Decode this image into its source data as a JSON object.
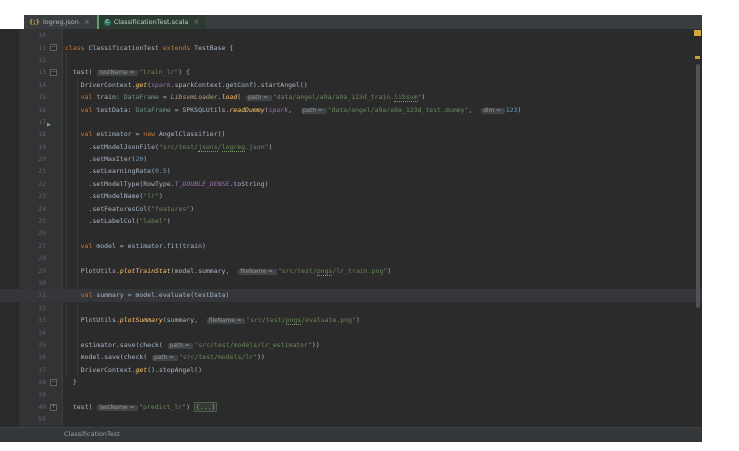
{
  "tabs": [
    {
      "label": "logreg.json",
      "icon": "json-file-icon",
      "close": "×",
      "active": false
    },
    {
      "label": "ClassificationTest.scala",
      "icon": "scala-test-class-icon",
      "close": "×",
      "active": true
    }
  ],
  "breadcrumb": "ClassificationTest",
  "colors": {
    "editor_bg": "#2b2b2b",
    "gutter_bg": "#313335",
    "tabbar_bg": "#3a3d3f",
    "active_tab_bg": "#2c3a31",
    "active_tab_accent": "#57a368",
    "keyword": "#cc7832",
    "string": "#6a8759",
    "number": "#6897bb",
    "default_text": "#a9b7c6",
    "line_number": "#606366",
    "error_stripe_marker": "#d4a740",
    "caret_line_bg": "#343639"
  },
  "editor": {
    "caret_line": 31,
    "lines": [
      {
        "n": 10,
        "t": []
      },
      {
        "n": 11,
        "fold": "minus",
        "t": [
          [
            "kw",
            "class "
          ],
          [
            "pl",
            "ClassificationTest "
          ],
          [
            "kw",
            "extends "
          ],
          [
            "pl",
            "TestBase {"
          ]
        ]
      },
      {
        "n": 12,
        "t": []
      },
      {
        "n": 13,
        "fold": "minus",
        "t": [
          [
            "pl",
            "  test( "
          ],
          [
            "hint",
            "testName = "
          ],
          [
            "str",
            "\"train_lr\""
          ],
          [
            "pl",
            ") {"
          ]
        ]
      },
      {
        "n": 14,
        "t": [
          [
            "pl",
            "    DriverContext."
          ],
          [
            "itm",
            "get"
          ],
          [
            "pl",
            "("
          ],
          [
            "fld",
            "spark"
          ],
          [
            "pl",
            ".sparkContext.getConf).startAngel()"
          ]
        ]
      },
      {
        "n": 15,
        "t": [
          [
            "kw",
            "    val "
          ],
          [
            "pl",
            "train: "
          ],
          [
            "typ",
            "DataFrame"
          ],
          [
            "pl",
            " = "
          ],
          [
            "obj",
            "LibsvmLoader"
          ],
          [
            "pl",
            "."
          ],
          [
            "itm",
            "load"
          ],
          [
            "pl",
            "( "
          ],
          [
            "hint",
            "path = "
          ],
          [
            "str",
            "\"data/angel/a9a/a9a_123d_train."
          ],
          [
            "ustr",
            "libsvm"
          ],
          [
            "str",
            "\""
          ],
          [
            "pl",
            ")"
          ]
        ]
      },
      {
        "n": 16,
        "t": [
          [
            "kw",
            "    val "
          ],
          [
            "pl",
            "testData: "
          ],
          [
            "typ",
            "DataFrame"
          ],
          [
            "pl",
            " = SPKSQLUtils."
          ],
          [
            "itm",
            "readDummy"
          ],
          [
            "pl",
            "("
          ],
          [
            "fld",
            "spark"
          ],
          [
            "pl",
            ",  "
          ],
          [
            "hint",
            "path = "
          ],
          [
            "str",
            "\"data/angel/a9a/a9a_123d_test.dummy\""
          ],
          [
            "pl",
            ",  "
          ],
          [
            "hint",
            "dim = "
          ],
          [
            "num",
            "123"
          ],
          [
            "pl",
            ")"
          ]
        ]
      },
      {
        "n": 17,
        "marker": "arrow",
        "t": []
      },
      {
        "n": 18,
        "t": [
          [
            "kw",
            "    val "
          ],
          [
            "pl",
            "estimator = "
          ],
          [
            "kw",
            "new "
          ],
          [
            "pl",
            "AngelClassifier()"
          ]
        ]
      },
      {
        "n": 19,
        "t": [
          [
            "pl",
            "      .setModelJsonFile("
          ],
          [
            "str",
            "\"src/test/"
          ],
          [
            "ustr",
            "jsons"
          ],
          [
            "str",
            "/"
          ],
          [
            "ustr",
            "logreg"
          ],
          [
            "str",
            ".json\""
          ],
          [
            "pl",
            ")"
          ]
        ]
      },
      {
        "n": 20,
        "t": [
          [
            "pl",
            "      .setMaxIter("
          ],
          [
            "num",
            "20"
          ],
          [
            "pl",
            ")"
          ]
        ]
      },
      {
        "n": 21,
        "t": [
          [
            "pl",
            "      .setLearningRate("
          ],
          [
            "num",
            "0.5"
          ],
          [
            "pl",
            ")"
          ]
        ]
      },
      {
        "n": 22,
        "t": [
          [
            "pl",
            "      .setModelType(RowType."
          ],
          [
            "fld",
            "T_DOUBLE_DENSE"
          ],
          [
            "pl",
            ".toString)"
          ]
        ]
      },
      {
        "n": 23,
        "t": [
          [
            "pl",
            "      .setModelName("
          ],
          [
            "str",
            "\"lr\""
          ],
          [
            "pl",
            ")"
          ]
        ]
      },
      {
        "n": 24,
        "t": [
          [
            "pl",
            "      .setFeaturesCol("
          ],
          [
            "str",
            "\"features\""
          ],
          [
            "pl",
            ")"
          ]
        ]
      },
      {
        "n": 25,
        "t": [
          [
            "pl",
            "      .setLabelCol("
          ],
          [
            "str",
            "\"label\""
          ],
          [
            "pl",
            ")"
          ]
        ]
      },
      {
        "n": 26,
        "t": []
      },
      {
        "n": 27,
        "t": [
          [
            "kw",
            "    val "
          ],
          [
            "pl",
            "model = estimator.fit(train)"
          ]
        ]
      },
      {
        "n": 28,
        "t": []
      },
      {
        "n": 29,
        "t": [
          [
            "pl",
            "    PlotUtils."
          ],
          [
            "itm",
            "plotTrainStat"
          ],
          [
            "pl",
            "(model.summary,  "
          ],
          [
            "hint",
            "fileName = "
          ],
          [
            "str",
            "\"src/test/"
          ],
          [
            "ustr",
            "pngs"
          ],
          [
            "str",
            "/lr_train.png\""
          ],
          [
            "pl",
            ")"
          ]
        ]
      },
      {
        "n": 30,
        "t": []
      },
      {
        "n": 31,
        "t": [
          [
            "kw",
            "    val "
          ],
          [
            "pl",
            "summary = model.evaluate(testData)"
          ]
        ]
      },
      {
        "n": 32,
        "t": []
      },
      {
        "n": 33,
        "t": [
          [
            "pl",
            "    PlotUtils."
          ],
          [
            "itm",
            "plotSummary"
          ],
          [
            "pl",
            "(summary,  "
          ],
          [
            "hint",
            "fileName = "
          ],
          [
            "str",
            "\"src/test/"
          ],
          [
            "ustr",
            "pngs"
          ],
          [
            "str",
            "/evaluate.png\""
          ],
          [
            "pl",
            ")"
          ]
        ]
      },
      {
        "n": 34,
        "t": []
      },
      {
        "n": 35,
        "t": [
          [
            "pl",
            "    estimator.save(check( "
          ],
          [
            "hint",
            "path = "
          ],
          [
            "str",
            "\"src/test/models/lr_estimator\""
          ],
          [
            "pl",
            "))"
          ]
        ]
      },
      {
        "n": 36,
        "t": [
          [
            "pl",
            "    model.save(check( "
          ],
          [
            "hint",
            "path = "
          ],
          [
            "str",
            "\"src/test/models/lr\""
          ],
          [
            "pl",
            "))"
          ]
        ]
      },
      {
        "n": 37,
        "t": [
          [
            "pl",
            "    DriverContext."
          ],
          [
            "itm",
            "get"
          ],
          [
            "pl",
            "().stopAngel()"
          ]
        ]
      },
      {
        "n": 38,
        "fold": "minus",
        "t": [
          [
            "pl",
            "  }"
          ]
        ]
      },
      {
        "n": 39,
        "t": []
      },
      {
        "n": 40,
        "fold": "plus",
        "t": [
          [
            "pl",
            "  test( "
          ],
          [
            "hint",
            "testName = "
          ],
          [
            "str",
            "\"predict_lr\""
          ],
          [
            "pl",
            ") "
          ],
          [
            "foldph",
            "{...}"
          ]
        ]
      },
      {
        "n": 59,
        "t": []
      }
    ]
  }
}
